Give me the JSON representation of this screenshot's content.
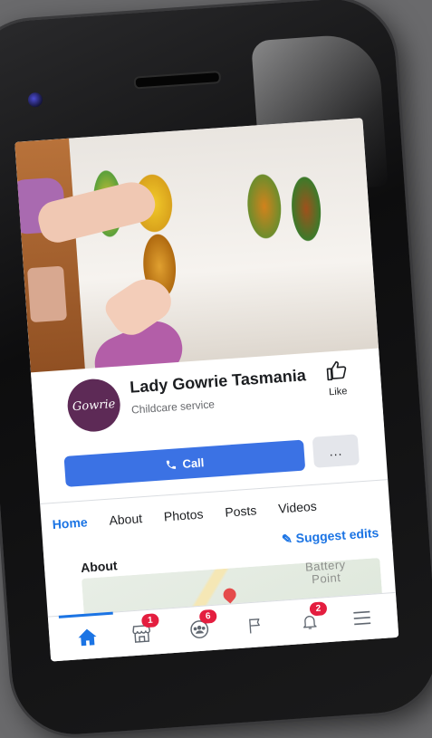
{
  "page": {
    "name": "Lady Gowrie Tasmania",
    "category": "Childcare service",
    "avatar_text": "Gowrie",
    "like_label": "Like"
  },
  "actions": {
    "call_label": "Call",
    "more_label": "..."
  },
  "tabs": [
    {
      "label": "Home",
      "active": true
    },
    {
      "label": "About"
    },
    {
      "label": "Photos"
    },
    {
      "label": "Posts"
    },
    {
      "label": "Videos"
    }
  ],
  "about": {
    "title": "About",
    "suggest_edits": "Suggest edits",
    "map_label_line1": "Battery",
    "map_label_line2": "Point"
  },
  "bottom_nav": {
    "marketplace_badge": "1",
    "groups_badge": "6",
    "notifications_badge": "2"
  },
  "colors": {
    "accent": "#1b74e4",
    "call_button": "#3b72e4",
    "avatar": "#5d2a56",
    "badge": "#e41e3f"
  }
}
